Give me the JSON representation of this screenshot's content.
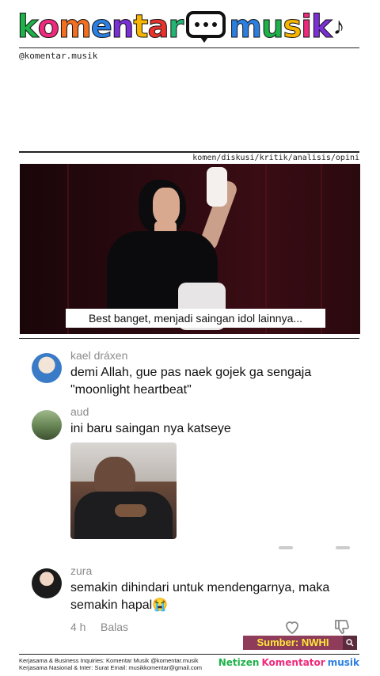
{
  "brand": {
    "word1_letters": [
      "k",
      "o",
      "m",
      "e",
      "n",
      "t",
      "a",
      "r"
    ],
    "word1_colors": [
      "#1fb24a",
      "#ef2a7c",
      "#f26f21",
      "#2b7fe1",
      "#7b2fd6",
      "#f7b500",
      "#e8322d",
      "#22b573"
    ],
    "word2_letters": [
      "m",
      "u",
      "s",
      "i",
      "k"
    ],
    "word2_colors": [
      "#2b7fe1",
      "#1fb24a",
      "#f7b500",
      "#ef2a7c",
      "#7b2fd6"
    ],
    "handle": "@komentar.musik",
    "tags": "komen/diskusi/kritik/analisis/opini"
  },
  "video": {
    "caption": "Best banget, menjadi saingan idol lainnya..."
  },
  "comments": [
    {
      "username": "kael dráxen",
      "text": "demi Allah, gue pas naek gojek ga sengaja \"moonlight heartbeat\""
    },
    {
      "username": "aud",
      "text": "ini baru saingan nya katseye"
    },
    {
      "username": "zura",
      "text": "semakin dihindari untuk mendengarnya, maka semakin hapal😭",
      "time": "4 h",
      "reply_label": "Balas"
    }
  ],
  "source": {
    "label": "Sumber: NWHI"
  },
  "footer": {
    "line1": "Kerjasama & Business Inquiries: Komentar Musik @komentar.musik",
    "line2": "Kerjasama Nasional & Inter: Surat Email: musikkomentar@gmail.com",
    "logo_word1": "Netizen",
    "logo_word2": "Komentator",
    "logo_word3": "musik"
  },
  "icons": {
    "like": "heart-icon",
    "dislike": "thumbs-down-icon",
    "search": "search-icon"
  }
}
